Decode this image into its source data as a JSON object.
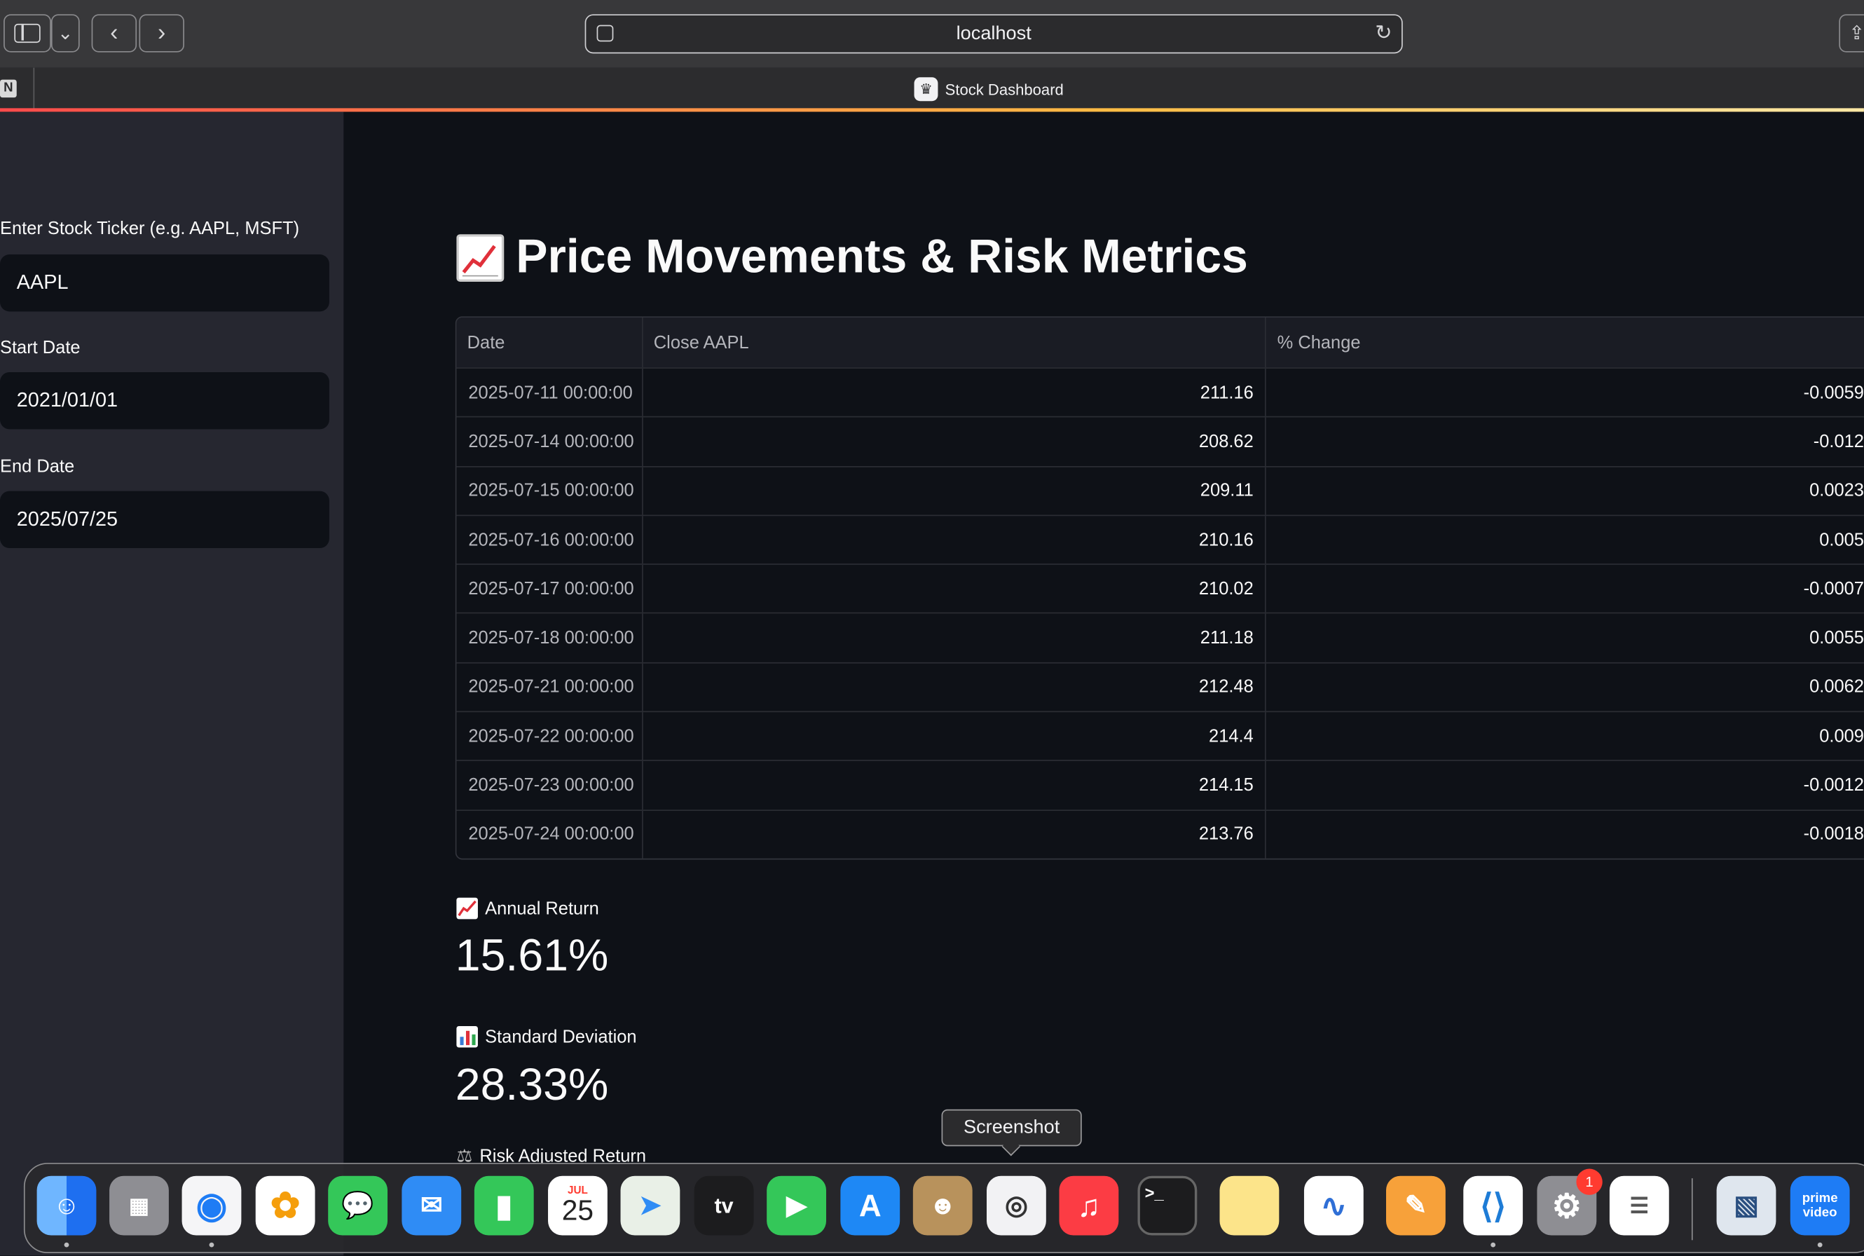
{
  "browser": {
    "url": "localhost",
    "tab_title": "Stock Dashboard",
    "pinned_tab_letter": "N"
  },
  "sidebar": {
    "ticker_label": "Enter Stock Ticker (e.g. AAPL, MSFT)",
    "ticker_value": "AAPL",
    "start_label": "Start Date",
    "start_value": "2021/01/01",
    "end_label": "End Date",
    "end_value": "2025/07/25"
  },
  "main": {
    "title": "Price Movements & Risk Metrics",
    "table": {
      "columns": [
        "Date",
        "Close AAPL",
        "% Change"
      ],
      "rows": [
        [
          "2025-07-11 00:00:00",
          "211.16",
          "-0.0059"
        ],
        [
          "2025-07-14 00:00:00",
          "208.62",
          "-0.012"
        ],
        [
          "2025-07-15 00:00:00",
          "209.11",
          "0.0023"
        ],
        [
          "2025-07-16 00:00:00",
          "210.16",
          "0.005"
        ],
        [
          "2025-07-17 00:00:00",
          "210.02",
          "-0.0007"
        ],
        [
          "2025-07-18 00:00:00",
          "211.18",
          "0.0055"
        ],
        [
          "2025-07-21 00:00:00",
          "212.48",
          "0.0062"
        ],
        [
          "2025-07-22 00:00:00",
          "214.4",
          "0.009"
        ],
        [
          "2025-07-23 00:00:00",
          "214.15",
          "-0.0012"
        ],
        [
          "2025-07-24 00:00:00",
          "213.76",
          "-0.0018"
        ]
      ]
    },
    "metrics": [
      {
        "label": "Annual Return",
        "value": "15.61%"
      },
      {
        "label": "Standard Deviation",
        "value": "28.33%"
      },
      {
        "label": "Risk Adjusted Return",
        "value": ""
      }
    ]
  },
  "dock": {
    "tooltip": "Screenshot",
    "calendar_month": "JUL",
    "calendar_day": "25",
    "tv_label": "tv",
    "badge_count": "1",
    "prime_label": "prime video"
  },
  "colors": {
    "sidebar_bg": "#262730",
    "main_bg": "#0e1117",
    "accent": "#ff4b4b"
  }
}
